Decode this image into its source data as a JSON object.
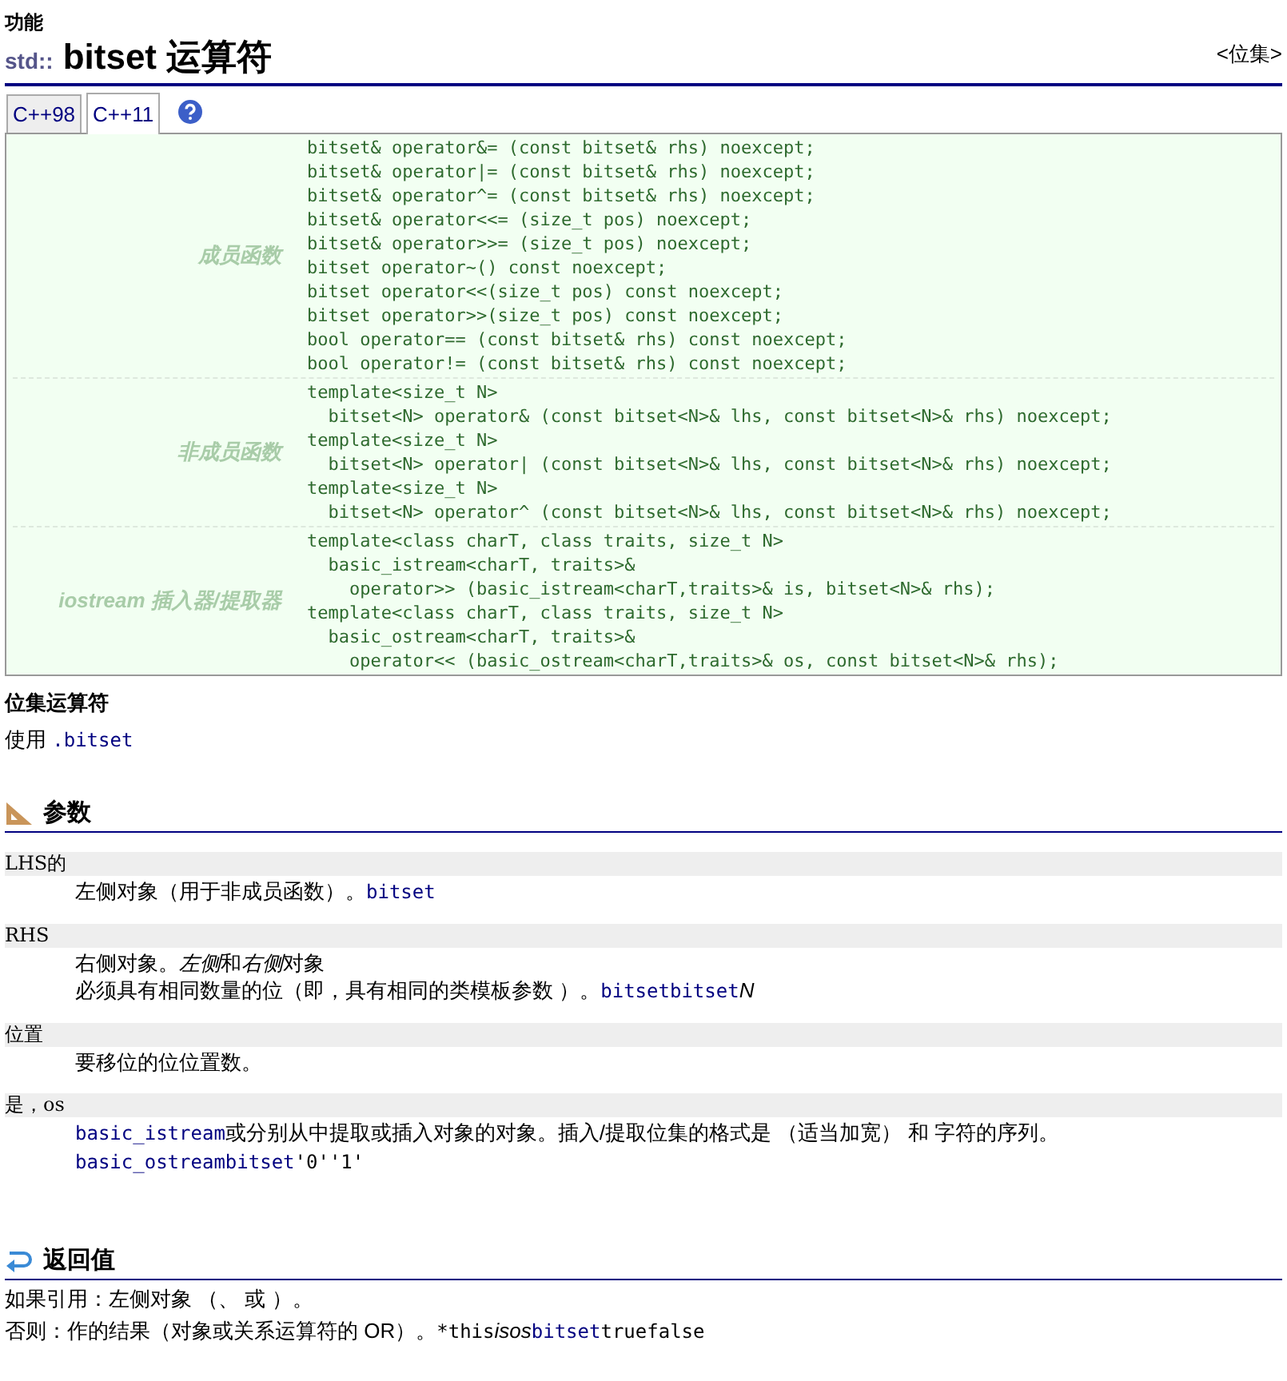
{
  "header": {
    "category": "功能",
    "namespace": "std::",
    "title": "bitset 运算符",
    "back_link": "<位集>"
  },
  "tabs": [
    {
      "label": "C++98",
      "selected": false
    },
    {
      "label": "C++11",
      "selected": true
    }
  ],
  "prototypes": [
    {
      "label": "成员函数",
      "lines": [
        "bitset& operator&= (const bitset& rhs) noexcept;",
        "bitset& operator|= (const bitset& rhs) noexcept;",
        "bitset& operator^= (const bitset& rhs) noexcept;",
        "bitset& operator<<= (size_t pos) noexcept;",
        "bitset& operator>>= (size_t pos) noexcept;",
        "bitset operator~() const noexcept;",
        "bitset operator<<(size_t pos) const noexcept;",
        "bitset operator>>(size_t pos) const noexcept;",
        "bool operator== (const bitset& rhs) const noexcept;",
        "bool operator!= (const bitset& rhs) const noexcept;"
      ]
    },
    {
      "label": "非成员函数",
      "lines": [
        "template<size_t N>",
        "  bitset<N> operator& (const bitset<N>& lhs, const bitset<N>& rhs) noexcept;",
        "template<size_t N>",
        "  bitset<N> operator| (const bitset<N>& lhs, const bitset<N>& rhs) noexcept;",
        "template<size_t N>",
        "  bitset<N> operator^ (const bitset<N>& lhs, const bitset<N>& rhs) noexcept;"
      ]
    },
    {
      "label": "iostream 插入器/提取器",
      "lines": [
        "template<class charT, class traits, size_t N>",
        "  basic_istream<charT, traits>&",
        "    operator>> (basic_istream<charT,traits>& is, bitset<N>& rhs);",
        "template<class charT, class traits, size_t N>",
        "  basic_ostream<charT, traits>&",
        "    operator<< (basic_ostream<charT,traits>& os, const bitset<N>& rhs);"
      ]
    }
  ],
  "summary": {
    "heading": "位集运算符",
    "paragraph": [
      {
        "kind": "text",
        "text": "使用 "
      },
      {
        "kind": "code",
        "text": ".bitset"
      }
    ]
  },
  "parameters": {
    "heading": "参数",
    "items": [
      {
        "term": "LHS的",
        "paragraphs": [
          [
            {
              "kind": "text",
              "text": "左侧对象（用于非成员函数）。"
            },
            {
              "kind": "code",
              "text": "bitset"
            }
          ]
        ]
      },
      {
        "term": "RHS",
        "paragraphs": [
          [
            {
              "kind": "text",
              "text": "右侧对象。"
            },
            {
              "kind": "italic",
              "text": "左侧"
            },
            {
              "kind": "text",
              "text": "和"
            },
            {
              "kind": "italic",
              "text": "右侧"
            },
            {
              "kind": "text",
              "text": "对象"
            }
          ],
          [
            {
              "kind": "text",
              "text": "必须具有相同数量的位（即，具有相同的类模板参数 ）。"
            },
            {
              "kind": "code",
              "text": "bitsetbitset"
            },
            {
              "kind": "italic",
              "text": "N"
            }
          ]
        ]
      },
      {
        "term": "位置",
        "paragraphs": [
          [
            {
              "kind": "text",
              "text": "要移位的位位置数。"
            }
          ]
        ]
      },
      {
        "term": "是，os",
        "paragraphs": [
          [
            {
              "kind": "code",
              "text": "basic_istream"
            },
            {
              "kind": "text",
              "text": "或分别从中提取或插入对象的对象。插入/提取位集的格式是 （适当加宽） 和 字符的序列。"
            }
          ],
          [
            {
              "kind": "code",
              "text": "basic_ostreambitset"
            },
            {
              "kind": "mono",
              "text": "'0''1'"
            }
          ]
        ]
      }
    ]
  },
  "return_value": {
    "heading": "返回值",
    "paragraphs": [
      [
        {
          "kind": "text",
          "text": "如果引用：左侧对象 （、 或 ）。"
        }
      ],
      [
        {
          "kind": "text",
          "text": "否则：作的结果（对象或关系运算符的 OR）。"
        },
        {
          "kind": "mono",
          "text": "*this"
        },
        {
          "kind": "italic",
          "text": "is"
        },
        {
          "kind": "italic",
          "text": "os"
        },
        {
          "kind": "code",
          "text": "bitset"
        },
        {
          "kind": "mono",
          "text": "truefalse"
        }
      ]
    ]
  }
}
